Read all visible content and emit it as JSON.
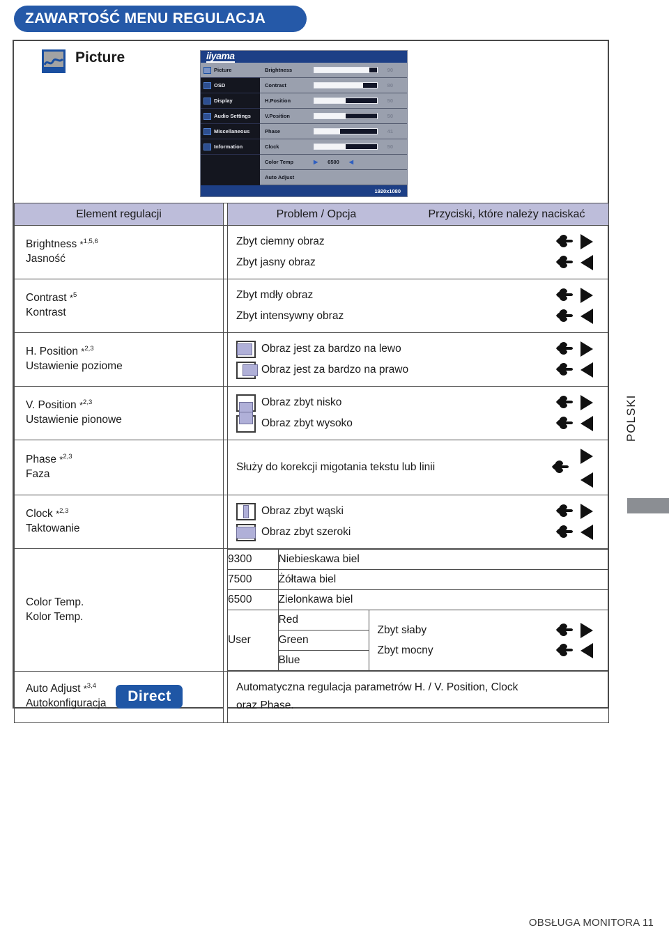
{
  "banner": {
    "title": "ZAWARTOŚĆ MENU REGULACJA"
  },
  "section": {
    "icon": "picture-icon",
    "title": "Picture"
  },
  "osd": {
    "logo": "iiyama",
    "resolution": "1920x1080",
    "nav": [
      {
        "label": "Picture",
        "icon": "picture-icon",
        "selected": true
      },
      {
        "label": "OSD",
        "icon": "osd-icon",
        "selected": false
      },
      {
        "label": "Display",
        "icon": "display-icon",
        "selected": false
      },
      {
        "label": "Audio Settings",
        "icon": "speaker-icon",
        "selected": false
      },
      {
        "label": "Miscellaneous",
        "icon": "wrench-icon",
        "selected": false
      },
      {
        "label": "Information",
        "icon": "info-icon",
        "selected": false
      }
    ],
    "items": [
      {
        "label": "Brightness",
        "value": "90",
        "fill": 88
      },
      {
        "label": "Contrast",
        "value": "80",
        "fill": 78
      },
      {
        "label": "H.Position",
        "value": "50",
        "fill": 50
      },
      {
        "label": "V.Position",
        "value": "50",
        "fill": 50
      },
      {
        "label": "Phase",
        "value": "41",
        "fill": 41
      },
      {
        "label": "Clock",
        "value": "50",
        "fill": 50
      }
    ],
    "color_temp": {
      "label": "Color Temp",
      "value": "6500",
      "left_arrow": "◀",
      "right_arrow": "▶"
    },
    "auto_adjust": {
      "label": "Auto Adjust"
    }
  },
  "table": {
    "headers": {
      "col1": "Element regulacji",
      "col2": "Problem / Opcja",
      "col3": "Przyciski, które należy naciskać"
    },
    "rows": [
      {
        "en": "Brightness",
        "sup": "1,5,6",
        "pl": "Jasność",
        "options": [
          {
            "text": "Zbyt ciemny obraz",
            "arrow": "right",
            "diagram": null
          },
          {
            "text": "Zbyt jasny obraz",
            "arrow": "left",
            "diagram": null
          }
        ]
      },
      {
        "en": "Contrast",
        "sup": "5",
        "pl": "Kontrast",
        "options": [
          {
            "text": "Zbyt mdły obraz",
            "arrow": "right",
            "diagram": null
          },
          {
            "text": "Zbyt intensywny obraz",
            "arrow": "left",
            "diagram": null
          }
        ]
      },
      {
        "en": "H. Position",
        "sup": "2,3",
        "pl": "Ustawienie poziome",
        "options": [
          {
            "text": "Obraz jest za bardzo na lewo",
            "arrow": "right",
            "diagram": "shift-left"
          },
          {
            "text": "Obraz jest za bardzo na prawo",
            "arrow": "left",
            "diagram": "shift-right"
          }
        ]
      },
      {
        "en": "V. Position",
        "sup": "2,3",
        "pl": "Ustawienie pionowe",
        "options": [
          {
            "text": "Obraz zbyt nisko",
            "arrow": "right",
            "diagram": "shift-down"
          },
          {
            "text": "Obraz zbyt wysoko",
            "arrow": "left",
            "diagram": "shift-up"
          }
        ]
      },
      {
        "en": "Phase",
        "sup": "2,3",
        "pl": "Faza",
        "single": "Służy do korekcji migotania tekstu lub linii"
      },
      {
        "en": "Clock",
        "sup": "2,3",
        "pl": "Taktowanie",
        "options": [
          {
            "text": "Obraz zbyt wąski",
            "arrow": "right",
            "diagram": "narrow"
          },
          {
            "text": "Obraz zbyt szeroki",
            "arrow": "left",
            "diagram": "wide"
          }
        ]
      }
    ],
    "color_temp_row": {
      "en": "Color Temp.",
      "pl": "Kolor Temp.",
      "presets": [
        {
          "value": "9300",
          "desc": "Niebieskawa biel"
        },
        {
          "value": "7500",
          "desc": "Żółtawa biel"
        },
        {
          "value": "6500",
          "desc": "Zielonkawa biel"
        }
      ],
      "user_label": "User",
      "channels": [
        "Red",
        "Green",
        "Blue"
      ],
      "user_options": [
        {
          "text": "Zbyt słaby",
          "arrow": "right"
        },
        {
          "text": "Zbyt mocny",
          "arrow": "left"
        }
      ]
    },
    "auto_adjust_row": {
      "en": "Auto Adjust",
      "sup": "3,4",
      "pl": "Autokonfiguracja",
      "badge": "Direct",
      "desc_line1": "Automatyczna regulacja parametrów H. / V. Position, Clock",
      "desc_line2": "oraz Phase."
    }
  },
  "side_tab": {
    "label": "POLSKI"
  },
  "footer": {
    "text": "OBSŁUGA MONITORA  11"
  },
  "colors": {
    "brand_blue": "#2559a8",
    "header_lavender": "#bdbdda",
    "diagram_fill": "#b0b0d8",
    "badge_blue": "#1f56a5"
  }
}
